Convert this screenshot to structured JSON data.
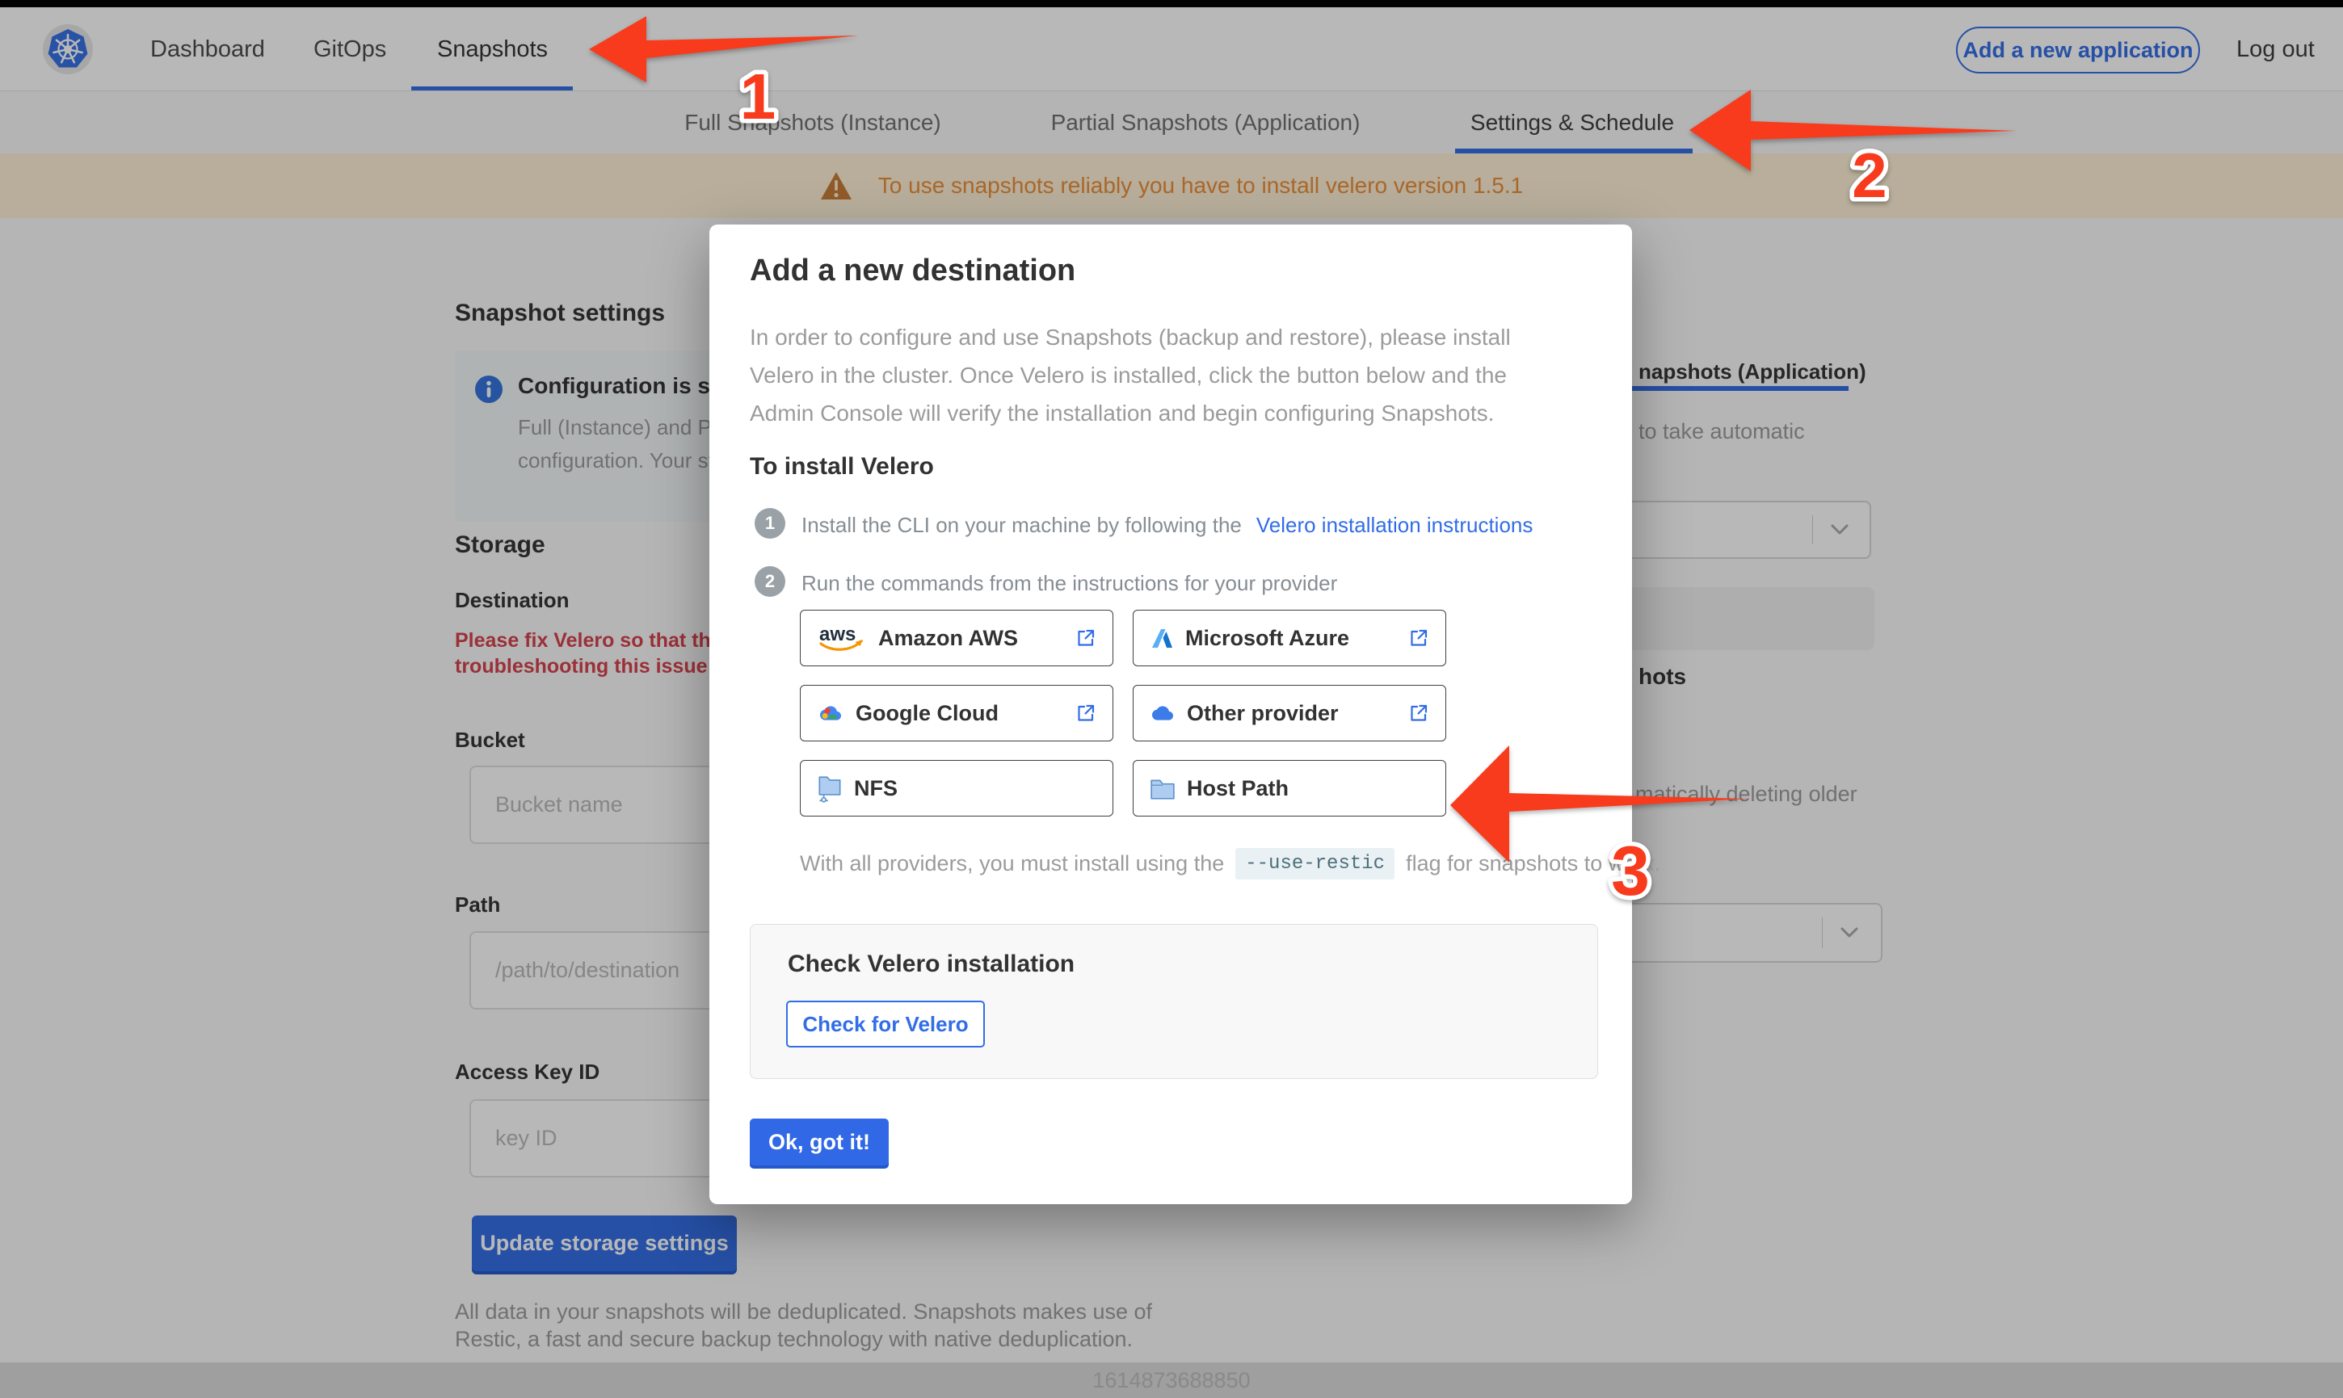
{
  "header": {
    "nav_items": [
      "Dashboard",
      "GitOps",
      "Snapshots"
    ],
    "active_nav": "Snapshots",
    "add_app_button": "Add a new application",
    "logout": "Log out"
  },
  "subnav": {
    "tabs": [
      "Full Snapshots (Instance)",
      "Partial Snapshots (Application)",
      "Settings & Schedule"
    ],
    "active_tab": "Settings & Schedule"
  },
  "warning_banner": {
    "text": "To use snapshots reliably you have to install velero version 1.5.1"
  },
  "snapshot_settings_page": {
    "title": "Snapshot settings",
    "info_box": {
      "title": "Configuration is sh",
      "line1": "Full (Instance) and Parti",
      "line2": "configuration. Your stor"
    },
    "storage_heading": "Storage",
    "destination_label": "Destination",
    "error_line1": "Please fix Velero so that th",
    "error_line2": "troubleshooting this issue",
    "bucket_label": "Bucket",
    "bucket_placeholder": "Bucket name",
    "path_label": "Path",
    "path_placeholder": "/path/to/destination",
    "access_key_label": "Access Key ID",
    "access_key_placeholder": "key ID",
    "update_button": "Update storage settings",
    "dedup_line1": "All data in your snapshots will be deduplicated. Snapshots makes use of",
    "dedup_line2": "Restic, a fast and secure backup technology with native deduplication.",
    "right_pane": {
      "tab_partial": "napshots (Application)",
      "schedule_hint": "to take automatic",
      "retention_heading": "hots",
      "retention_hint": "matically deleting older"
    }
  },
  "modal": {
    "title": "Add a new destination",
    "body": "In order to configure and use Snapshots (backup and restore), please install\nVelero in the cluster. Once Velero is installed, click the button below and the\nAdmin Console will verify the installation and begin configuring Snapshots.",
    "install_heading": "To install Velero",
    "steps": [
      {
        "num": "1",
        "text": "Install the CLI on your machine by following the",
        "link": "Velero installation instructions"
      },
      {
        "num": "2",
        "text": "Run the commands from the instructions for your provider"
      }
    ],
    "providers": [
      {
        "label": "Amazon AWS"
      },
      {
        "label": "Microsoft Azure"
      },
      {
        "label": "Google Cloud"
      },
      {
        "label": "Other provider"
      },
      {
        "label": "NFS"
      },
      {
        "label": "Host Path"
      }
    ],
    "restic_note": {
      "before": "With all providers, you must install using the",
      "code": "--use-restic",
      "after": "flag for snapshots to work."
    },
    "check_section": {
      "heading": "Check Velero installation",
      "button": "Check for Velero"
    },
    "ok_button": "Ok, got it!"
  },
  "annotations": {
    "step1": "1",
    "step2": "2",
    "step3": "3"
  },
  "footer": {
    "timestamp": "1614873688850"
  },
  "colors": {
    "accent_blue": "#326de6",
    "warning_bg": "#fff1d6",
    "warning_text": "#ec8f39",
    "error_red": "#d6404b",
    "annotation_red": "#f93b1d"
  }
}
